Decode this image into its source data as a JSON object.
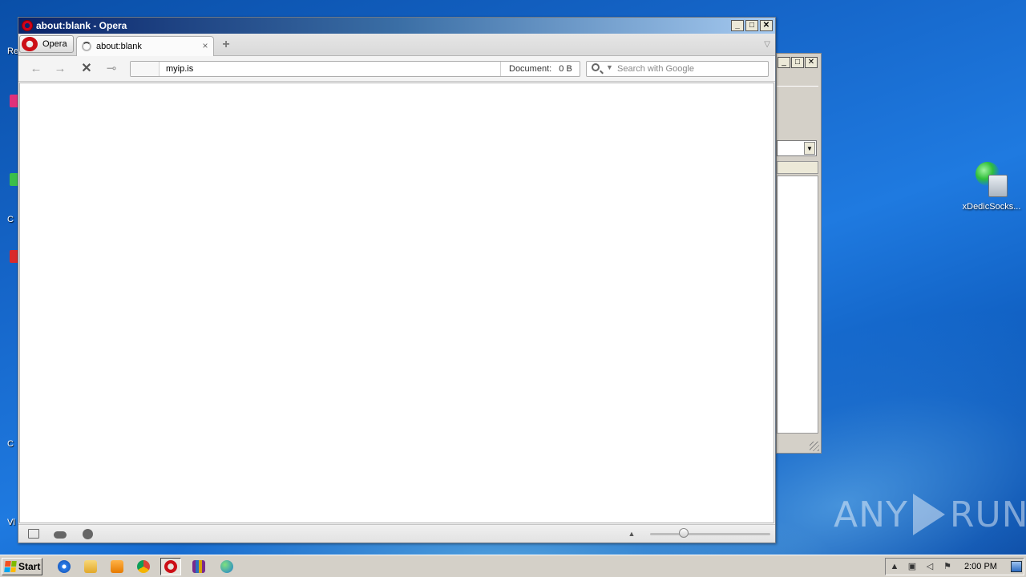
{
  "desktop": {
    "left_labels": [
      "Re",
      "C",
      "C",
      "Vl"
    ],
    "right_icon": {
      "label": "xDedicSocks...",
      "icon": "network-computer-icon"
    },
    "watermark": {
      "left": "ANY",
      "right": "RUN"
    }
  },
  "opera": {
    "window_title": "about:blank - Opera",
    "menu_label": "Opera",
    "tab_title": "about:blank",
    "address_value": "myip.is",
    "document_label": "Document:",
    "document_size": "0 B",
    "search_placeholder": "Search with Google",
    "zoom_fraction": 0.28
  },
  "taskbar": {
    "start_label": "Start",
    "clock": "2:00 PM",
    "items": [
      "internet-explorer-icon",
      "folder-icon",
      "media-player-icon",
      "chrome-icon",
      "opera-icon",
      "winrar-icon",
      "network-app-icon"
    ],
    "active_item": "opera-icon"
  },
  "colors": {
    "opera_red": "#cc0f16",
    "titlebar_start": "#0a246a",
    "titlebar_end": "#a6caf0",
    "desktop_blue": "#1565c8"
  }
}
